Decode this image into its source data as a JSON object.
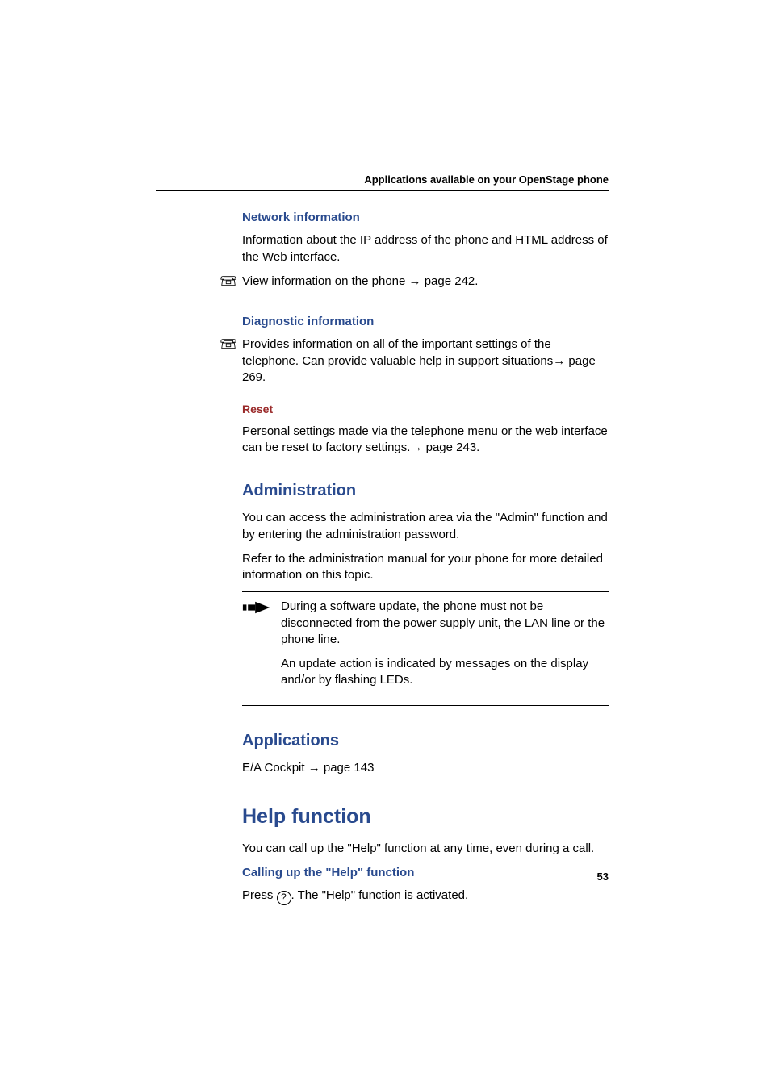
{
  "running_head": "Applications available on your OpenStage phone",
  "page_number": "53",
  "sections": {
    "network": {
      "title": "Network information",
      "p1": "Information about the IP address of the phone and HTML address of the Web interface.",
      "p2_prefix": "View information on the phone ",
      "p2_arrow": "→",
      "p2_suffix": " page 242."
    },
    "diagnostic": {
      "title": "Diagnostic information",
      "p1_prefix": "Provides information on all of the important settings of the telephone. Can provide valuable help in support situations",
      "p1_arrow": "→",
      "p1_suffix": " page 269."
    },
    "reset": {
      "title": "Reset",
      "p1_prefix": "Personal settings made via the telephone menu or the web interface can be reset to factory settings.",
      "p1_arrow": "→",
      "p1_suffix": " page 243."
    },
    "administration": {
      "title": "Administration",
      "p1": "You can access the administration area via the \"Admin\" function and by entering the administration password.",
      "p2": "Refer to the administration manual for your phone for more detailed information on this topic.",
      "note1": "During a software update, the phone must not be disconnected from the power supply unit, the LAN line or the phone line.",
      "note2": "An update action is indicated by messages on the display and/or by flashing LEDs."
    },
    "applications": {
      "title": "Applications",
      "p1_prefix": "E/A Cockpit ",
      "p1_arrow": "→",
      "p1_suffix": " page 143"
    },
    "help": {
      "title": "Help function",
      "p1": "You can call up the \"Help\" function at any time, even during a call.",
      "subhead": "Calling up the \"Help\" function",
      "p2_prefix": "Press ",
      "p2_key": "?",
      "p2_suffix": ". The \"Help\" function is activated."
    }
  }
}
